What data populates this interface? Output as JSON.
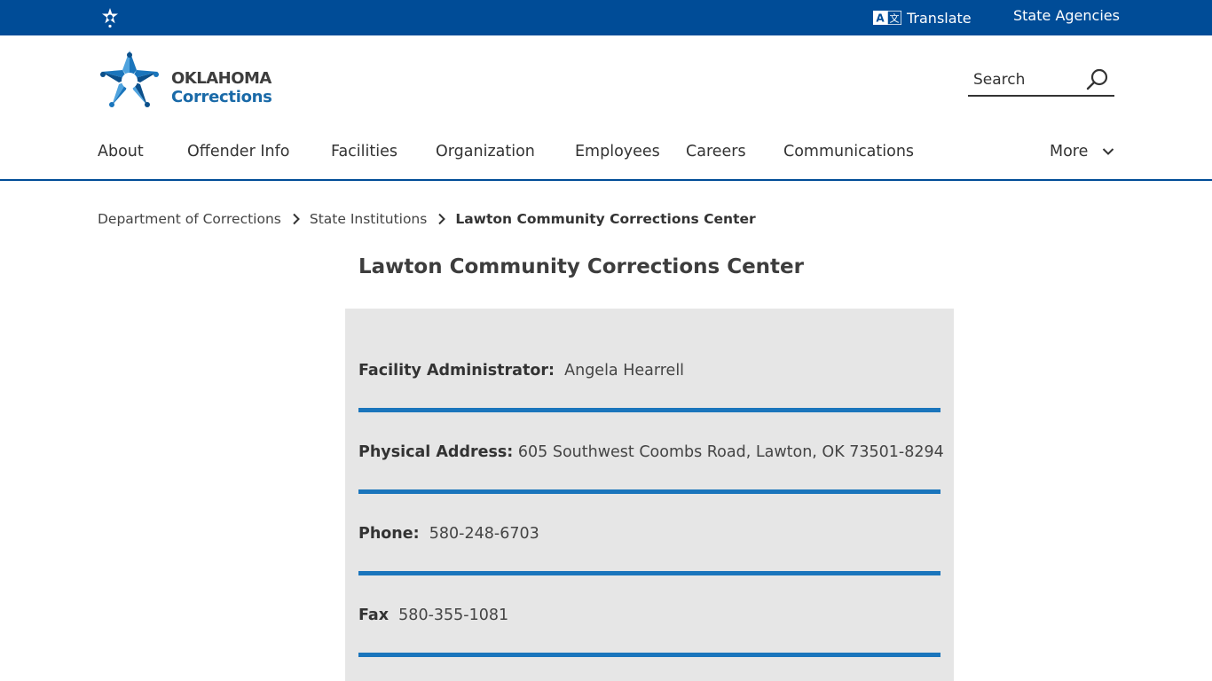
{
  "topbar": {
    "translate_label": "Translate",
    "agencies_label": "State Agencies",
    "bg_color": "#004c97"
  },
  "logo": {
    "line1": "OKLAHOMA",
    "line2": "Corrections"
  },
  "search": {
    "placeholder": "Search"
  },
  "nav": {
    "items": [
      "About",
      "Offender Info",
      "Facilities",
      "Organization",
      "Employees",
      "Careers",
      "Communications"
    ],
    "more_label": "More"
  },
  "breadcrumb": {
    "items": [
      "Department of Corrections",
      "State Institutions"
    ],
    "current": "Lawton Community Corrections Center"
  },
  "page": {
    "title": "Lawton Community Corrections Center"
  },
  "facility": {
    "rows": [
      {
        "label": "Facility Administrator:",
        "value": "Angela Hearrell"
      },
      {
        "label": "Physical Address:",
        "value": "605 Southwest Coombs Road, Lawton, OK 73501-8294"
      },
      {
        "label": "Phone:",
        "value": "580-248-6703"
      },
      {
        "label": "Fax",
        "value": "580-355-1081"
      }
    ]
  },
  "colors": {
    "accent_blue": "#1a75bc",
    "card_bg": "#e6e6e6"
  }
}
